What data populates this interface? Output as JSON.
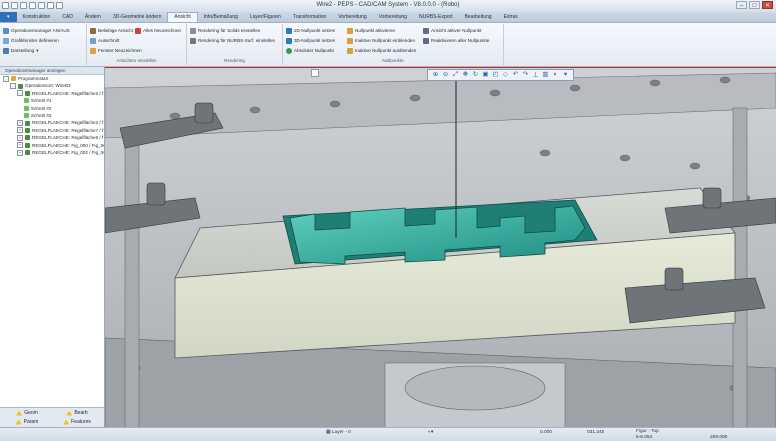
{
  "window": {
    "title": "Wire2 - PEPS - CAD/CAM System - V8.0.0.0 - (Robo)"
  },
  "tabs": [
    "Konstruktion",
    "CAD",
    "Ändern",
    "3D-Geometrie ändern",
    "Ansicht",
    "Info/Bemaßung",
    "Layer/Figuren",
    "Transformation",
    "Vorbereitung",
    "Vorbereitung",
    "NURBS-Export",
    "Bearbeitung",
    "Extras"
  ],
  "active_tab_index": 4,
  "ribbon": {
    "group1": {
      "items": [
        "Operationsmanager AN/AUS",
        "Grafikfenster definieren",
        "Darstellung"
      ]
    },
    "group2": {
      "name": "Ansichten einstellen",
      "items": [
        "Beliebige Ansicht",
        "Ausschnitt",
        "Fenster Neuzeichnen",
        "Alles Neuzeichnen"
      ]
    },
    "group3": {
      "name": "Rendering",
      "items": [
        "Rendering für Solids einstellen",
        "Rendering für NURBS-Surf. einstellen"
      ]
    },
    "group4": {
      "name": "Nullpunkte",
      "items": [
        "2D-Nullpunkt setzen",
        "3D-Nullpunkt setzen",
        "Absoluter Nullpunkt",
        "Nullpunkt aktivieren",
        "Inaktive Nullpunkt einblenden",
        "Inaktive Nullpunkt ausblenden",
        "Ansicht aktiver Nullpunkt",
        "Reaktivieren aller Nullpunkte"
      ]
    }
  },
  "left_panel": {
    "header": "Operationsmanager anzeigen",
    "tree": [
      {
        "label": "Programmstart",
        "level": 0,
        "expander": "-"
      },
      {
        "label": "Operationsort: WireD2",
        "level": 1,
        "expander": "-"
      },
      {
        "label": "REGELFLAECHE: Regelfläche2 / f",
        "level": 2,
        "expander": "-"
      },
      {
        "label": "Schnitt #1",
        "level": 3,
        "expander": ""
      },
      {
        "label": "Schnitt #2",
        "level": 3,
        "expander": ""
      },
      {
        "label": "Schnitt #3",
        "level": 3,
        "expander": ""
      },
      {
        "label": "REGELFLAECHE: Regelfläche2 / f",
        "level": 2,
        "expander": "+"
      },
      {
        "label": "REGELFLAECHE: Regelfläche7 / f",
        "level": 2,
        "expander": "+"
      },
      {
        "label": "REGELFLAECHE: Regelfläche6 / f",
        "level": 2,
        "expander": "+"
      },
      {
        "label": "REGELFLAECHE: Fig_000 / Fig_0C",
        "level": 2,
        "expander": "+"
      },
      {
        "label": "REGELFLAECHE: Fig_002 / Fig_0C",
        "level": 2,
        "expander": "+"
      }
    ],
    "bottom_tabs": [
      "Geom",
      "Bearb",
      "Param",
      "Features"
    ]
  },
  "viewport": {
    "toolbar_icons": [
      "zoom-in",
      "zoom-out",
      "fit",
      "pan",
      "rotate",
      "view-front",
      "view-top",
      "view-iso",
      "undo-view",
      "redo-view",
      "measure",
      "section",
      "shading",
      "display-mode"
    ]
  },
  "status": {
    "layer": "Layer - 0",
    "zoom": "0.000",
    "coord": "031.245",
    "figur_label": "Figur - Top",
    "figur_val": "0.000",
    "value_a": "5-6.054",
    "value_b": "259.000"
  },
  "colors": {
    "accent": "#2f6fb8",
    "toolpath": "#2fb09a",
    "viewport_border": "#c22a2a"
  }
}
